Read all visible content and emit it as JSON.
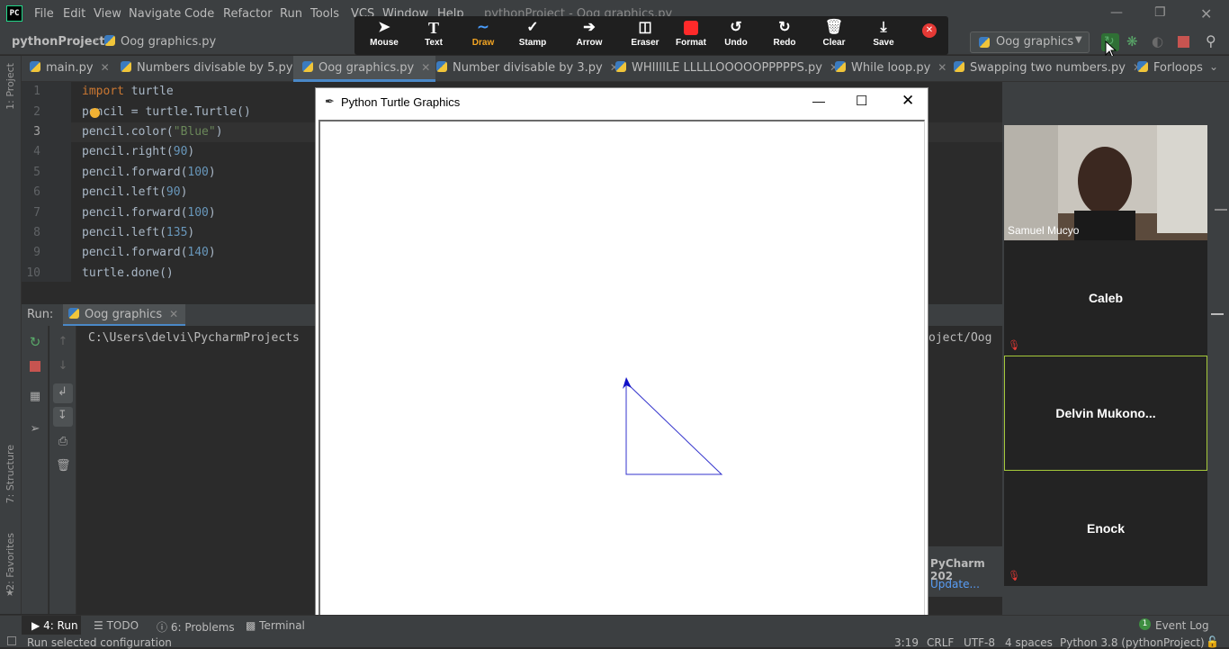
{
  "menubar": {
    "items": [
      "File",
      "Edit",
      "View",
      "Navigate",
      "Code",
      "Refactor",
      "Run",
      "Tools",
      "VCS",
      "Window",
      "Help"
    ],
    "title": "pythonProject - Oog graphics.py"
  },
  "navbar": {
    "project": "pythonProject",
    "file": "Oog graphics.py"
  },
  "zoom_toolbar": {
    "buttons": [
      "Mouse",
      "Text",
      "Draw",
      "Stamp",
      "Arrow",
      "Eraser",
      "Format",
      "Undo",
      "Redo",
      "Clear",
      "Save"
    ],
    "active": "Draw",
    "accent": "#4a9eff",
    "close_color": "#e53935"
  },
  "run_config": {
    "label": "Oog graphics"
  },
  "tabs": [
    {
      "label": "main.py"
    },
    {
      "label": "Numbers divisable by 5.py"
    },
    {
      "label": "Oog graphics.py"
    },
    {
      "label": "Number divisable by 3.py"
    },
    {
      "label": "WHIIIILE LLLLLOOOOOPPPPPS.py"
    },
    {
      "label": "While loop.py"
    },
    {
      "label": "Swapping two numbers.py"
    },
    {
      "label": "Forloops"
    }
  ],
  "editor": {
    "line_numbers": [
      "1",
      "2",
      "3",
      "4",
      "5",
      "6",
      "7",
      "8",
      "9",
      "10"
    ],
    "lines": [
      {
        "kw": "import",
        "rest": " turtle"
      },
      {
        "text": "pencil = turtle.Turtle()"
      },
      {
        "pre": "pencil.color(",
        "str": "\"Blue\"",
        "post": ")"
      },
      {
        "pre": "pencil.right(",
        "num": "90",
        "post": ")"
      },
      {
        "pre": "pencil.forward(",
        "num": "100",
        "post": ")"
      },
      {
        "pre": "pencil.left(",
        "num": "90",
        "post": ")"
      },
      {
        "pre": "pencil.forward(",
        "num": "100",
        "post": ")"
      },
      {
        "pre": "pencil.left(",
        "num": "135",
        "post": ")"
      },
      {
        "pre": "pencil.forward(",
        "num": "140",
        "post": ")"
      },
      {
        "text": "turtle.done()"
      }
    ],
    "warning_count": "1"
  },
  "run_panel": {
    "label": "Run:",
    "tab": "Oog graphics",
    "console_left": "C:\\Users\\delvi\\PycharmProjects",
    "console_right": "oject/Oog"
  },
  "side_labels": {
    "project": "1: Project",
    "structure": "7: Structure",
    "favorites": "2: Favorites"
  },
  "bottom_tabs": {
    "run": "4: Run",
    "todo": "TODO",
    "problems": "6: Problems",
    "terminal": "Terminal",
    "event_log": "Event Log",
    "event_count": "1"
  },
  "status": {
    "message": "Run selected configuration",
    "position": "3:19",
    "line_sep": "CRLF",
    "encoding": "UTF-8",
    "indent": "4 spaces",
    "interpreter": "Python 3.8 (pythonProject)"
  },
  "turtle_window": {
    "title": "Python Turtle Graphics",
    "pen_color": "#3333cc"
  },
  "participants": [
    {
      "name": "Samuel Mucyo",
      "video": true
    },
    {
      "name": "Caleb",
      "muted": true
    },
    {
      "name": "Delvin  Mukono...",
      "speaking": true,
      "highlight": "#a6c93a"
    },
    {
      "name": "Enock",
      "muted": true
    }
  ],
  "notification": {
    "title": "PyCharm 202",
    "link": "Update..."
  }
}
